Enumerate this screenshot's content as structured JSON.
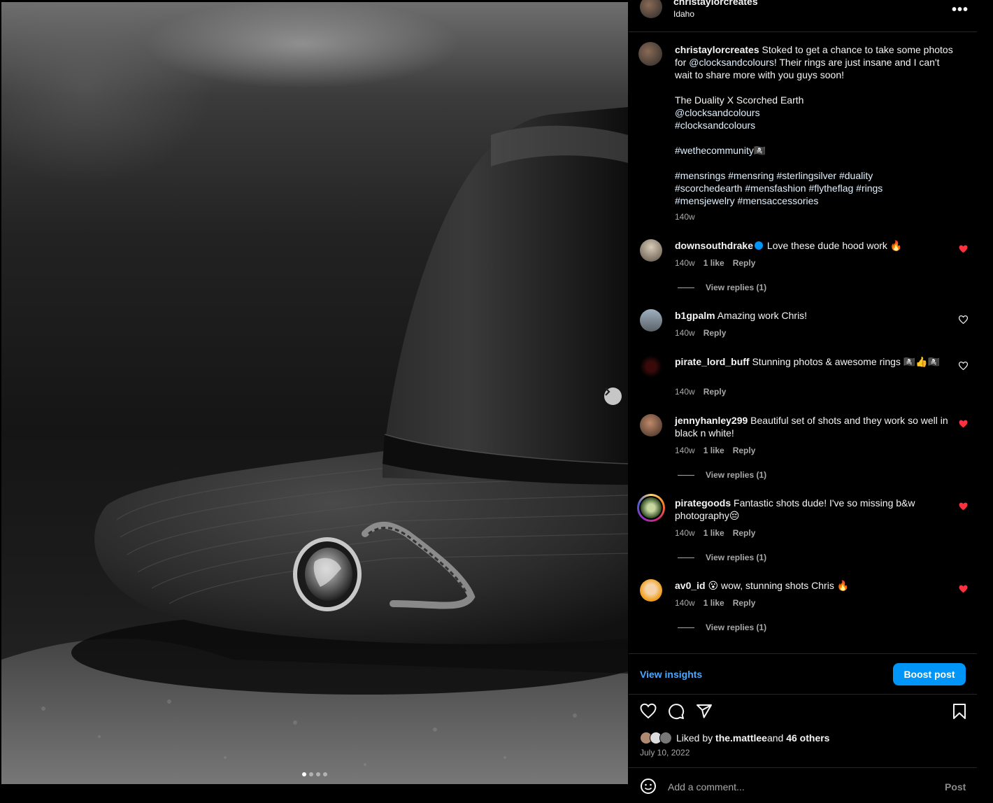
{
  "post": {
    "username": "christaylorcreates",
    "location": "Idaho",
    "more_label": "•••",
    "carousel": {
      "slide_count": 4,
      "active_slide": 1
    }
  },
  "caption": {
    "username": "christaylorcreates",
    "line1": "Stoked to get a chance to take some photos for ",
    "mention": "@clocksandcolours",
    "line1_rest": "! Their rings are just insane and I can't wait to share more with you guys soon!",
    "title": "The Duality X Scorched Earth",
    "mention2": "@clocksandcolours",
    "tag1": "#clocksandcolours",
    "tag2": "#wethecommunity🏴‍☠️",
    "tags_line1": "#mensrings #mensring #sterlingsilver #duality",
    "tags_line2": "#scorchedearth #mensfashion #flytheflag #rings",
    "tags_line3": "#mensjewelry #mensaccessories",
    "age": "140w"
  },
  "comments": [
    {
      "username": "downsouthdrake",
      "verified": true,
      "text": "Love these dude hood work 🔥",
      "age": "140w",
      "likes": "1 like",
      "reply": "Reply",
      "view_replies": "View replies (1)",
      "liked": true
    },
    {
      "username": "b1gpalm",
      "text": "Amazing work Chris!",
      "age": "140w",
      "reply": "Reply",
      "liked": false
    },
    {
      "username": "pirate_lord_buff",
      "text": "Stunning photos & awesome rings 🏴‍☠️👍🏴‍☠️",
      "age": "140w",
      "reply": "Reply",
      "liked": false
    },
    {
      "username": "jennyhanley299",
      "text": "Beautiful set of shots and they work so well in black n white!",
      "age": "140w",
      "likes": "1 like",
      "reply": "Reply",
      "view_replies": "View replies (1)",
      "liked": true
    },
    {
      "username": "pirategoods",
      "text": "Fantastic shots dude! I've so missing b&w photography😔",
      "age": "140w",
      "likes": "1 like",
      "reply": "Reply",
      "view_replies": "View replies (1)",
      "liked": true
    },
    {
      "username": "av0_id",
      "text": "😮 wow, stunning shots Chris 🔥",
      "age": "140w",
      "likes": "1 like",
      "reply": "Reply",
      "view_replies": "View replies (1)",
      "liked": true
    }
  ],
  "insights": {
    "link": "View insights",
    "boost": "Boost post"
  },
  "likes": {
    "prefix": "Liked by ",
    "user": "the.mattlee",
    "and": " and ",
    "others": "46 others"
  },
  "date": "July 10, 2022",
  "add_comment": {
    "placeholder": "Add a comment...",
    "post": "Post"
  },
  "colors": {
    "accent": "#0095f6",
    "heart_red": "#ff3040",
    "muted": "#a8a8a8"
  },
  "icons": [
    "more-icon",
    "heart-icon",
    "comment-icon",
    "share-icon",
    "bookmark-icon",
    "emoji-icon",
    "chevron-right-icon",
    "verified-icon"
  ]
}
